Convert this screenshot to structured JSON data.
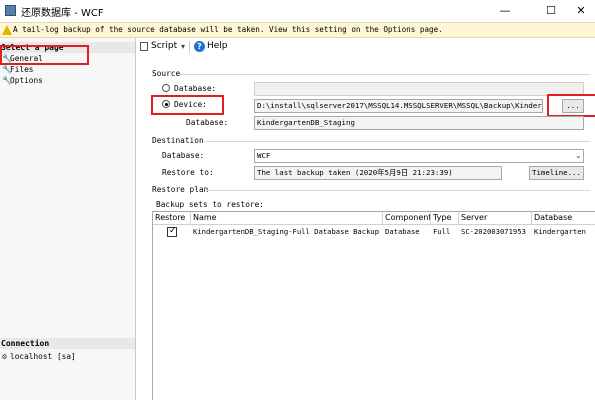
{
  "window": {
    "title": "还原数据库 - WCF",
    "controls": {
      "minimize": "—",
      "maximize": "☐",
      "close": "✕"
    }
  },
  "warning": {
    "text": "A tail-log backup of the source database will be taken. View this setting on the Options page."
  },
  "left": {
    "select_page_header": "Select a page",
    "pages": [
      "General",
      "Files",
      "Options"
    ],
    "connection_header": "Connection",
    "connection_value": "localhost [sa]"
  },
  "toolbar": {
    "script_label": "Script",
    "help_label": "Help"
  },
  "source": {
    "section_label": "Source",
    "database_radio_label": "Database:",
    "device_radio_label": "Device:",
    "device_path": "D:\\install\\sqlserver2017\\MSSQL14.MSSQLSERVER\\MSSQL\\Backup\\Kindergart",
    "browse_label": "...",
    "database_label": "Database:",
    "database_value": "KindergartenDB_Staging"
  },
  "destination": {
    "section_label": "Destination",
    "database_label": "Database:",
    "database_value": "WCF",
    "restore_to_label": "Restore to:",
    "restore_to_value": "The last backup taken (2020年5月9日 21:23:39)",
    "timeline_label": "Timeline..."
  },
  "restore_plan": {
    "section_label": "Restore plan",
    "backup_sets_label": "Backup sets to restore:",
    "columns": [
      "Restore",
      "Name",
      "Component",
      "Type",
      "Server",
      "Database"
    ],
    "rows": [
      {
        "restore": true,
        "name": "KindergartenDB_Staging-Full Database Backup",
        "component": "Database",
        "type": "Full",
        "server": "SC-202003071953",
        "database": "Kindergarten"
      }
    ]
  },
  "colors": {
    "highlight_box": "#e02020",
    "warning_bg": "#fff6d5",
    "help_icon": "#1e73c8"
  }
}
